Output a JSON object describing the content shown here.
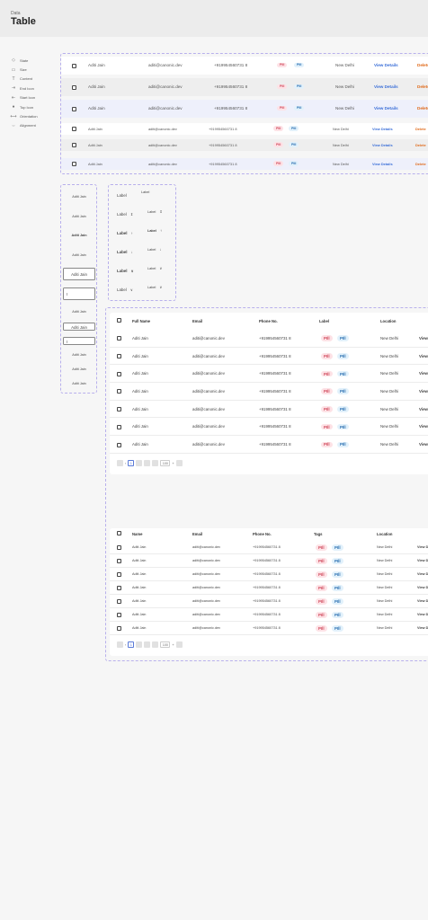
{
  "header": {
    "breadcrumb": "Data",
    "title": "Table"
  },
  "sidebar": [
    {
      "label": "State",
      "icon": "diamond-icon"
    },
    {
      "label": "Size",
      "icon": "size-icon"
    },
    {
      "label": "Content",
      "icon": "text-icon"
    },
    {
      "label": "End Icon",
      "icon": "end-icon"
    },
    {
      "label": "Start Icon",
      "icon": "start-icon"
    },
    {
      "label": "Top Icon",
      "icon": "top-icon"
    },
    {
      "label": "Orientation",
      "icon": "orientation-icon"
    },
    {
      "label": "Alignment",
      "icon": "alignment-icon"
    }
  ],
  "row": {
    "name": "Aditi Jain",
    "email": "aditi@canonic.dev",
    "phone": "+919954560731 8",
    "pill1": "PIll",
    "pill2": "PIll",
    "location": "New Delhi",
    "view": "View Details",
    "delete": "Delete"
  },
  "name_cells": [
    "Aditi Jain",
    "Aditi Jain",
    "Aditi Jain",
    "Aditi Jain",
    "Aditi Jain",
    "I",
    "Aditi Jain",
    "Aditi Jain",
    "I",
    "Aditi Jain",
    "Aditi Jain",
    "Aditi Jain"
  ],
  "label_cells": [
    "Label",
    "Label",
    "Label",
    "Label",
    "Label",
    "Label",
    "Label",
    "Label",
    "Label",
    "Label",
    "Label",
    "Label"
  ],
  "table1": {
    "headers": [
      "Full Name",
      "Email",
      "Phone No.",
      "Label",
      "Location"
    ],
    "rows": [
      [
        "Aditi Jain",
        "aditi@canonic.dev",
        "+919954560731 8",
        "PIll",
        "PIll",
        "New Delhi",
        "View"
      ],
      [
        "Aditi Jain",
        "aditi@canonic.dev",
        "+919954560731 8",
        "PIll",
        "PIll",
        "New Delhi",
        "View"
      ],
      [
        "Aditi Jain",
        "aditi@canonic.dev",
        "+919954560731 8",
        "PIll",
        "PIll",
        "New Delhi",
        "View"
      ],
      [
        "Aditi Jain",
        "aditi@canonic.dev",
        "+919954560731 8",
        "PIll",
        "PIll",
        "New Delhi",
        "View"
      ],
      [
        "Aditi Jain",
        "aditi@canonic.dev",
        "+919954560731 8",
        "PIll",
        "PIll",
        "New Delhi",
        "View"
      ],
      [
        "Aditi Jain",
        "aditi@canonic.dev",
        "+919954560731 8",
        "PIll",
        "PIll",
        "New Delhi",
        "View"
      ],
      [
        "Aditi Jain",
        "aditi@canonic.dev",
        "+919954560731 8",
        "PIll",
        "PIll",
        "New Delhi",
        "View"
      ]
    ],
    "pagination": {
      "current": "1",
      "per_page": "100"
    }
  },
  "table2": {
    "headers": [
      "Name",
      "Email",
      "Phone No.",
      "Tags",
      "Location"
    ],
    "rows": [
      [
        "Aditi Jain",
        "aditi@canonic.dev",
        "+919954560731 8",
        "PIll",
        "PIll",
        "New Delhi",
        "View D"
      ],
      [
        "Aditi Jain",
        "aditi@canonic.dev",
        "+919954560731 8",
        "PIll",
        "PIll",
        "New Delhi",
        "View D"
      ],
      [
        "Aditi Jain",
        "aditi@canonic.dev",
        "+919954560731 8",
        "PIll",
        "PIll",
        "New Delhi",
        "View D"
      ],
      [
        "Aditi Jain",
        "aditi@canonic.dev",
        "+919954560731 8",
        "PIll",
        "PIll",
        "New Delhi",
        "View D"
      ],
      [
        "Aditi Jain",
        "aditi@canonic.dev",
        "+919954560731 8",
        "PIll",
        "PIll",
        "New Delhi",
        "View D"
      ],
      [
        "Aditi Jain",
        "aditi@canonic.dev",
        "+919954560731 8",
        "PIll",
        "PIll",
        "New Delhi",
        "View D"
      ],
      [
        "Aditi Jain",
        "aditi@canonic.dev",
        "+919954560731 8",
        "PIll",
        "PIll",
        "New Delhi",
        "View D"
      ]
    ],
    "pagination": {
      "current": "1",
      "per_page": "100"
    }
  }
}
